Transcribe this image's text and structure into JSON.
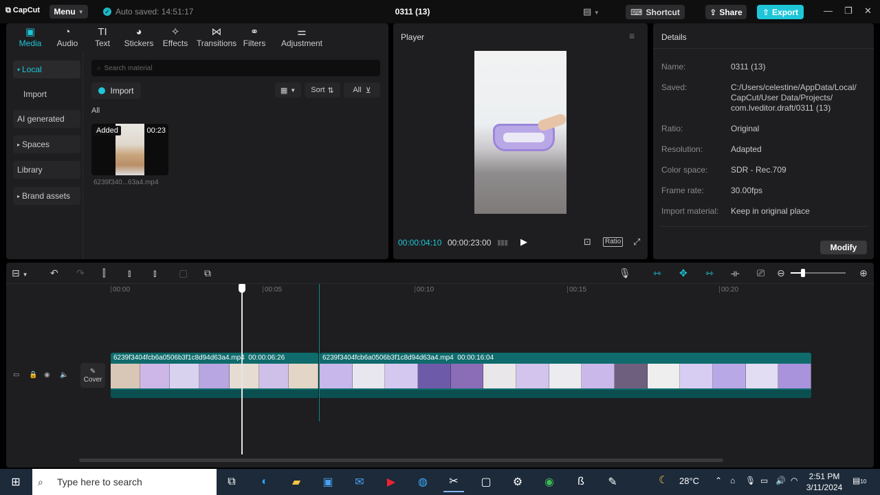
{
  "titlebar": {
    "logo": "CapCut",
    "menu_label": "Menu",
    "autosave_text": "Auto saved: 14:51:17",
    "project_title": "0311 (13)",
    "shortcut_label": "Shortcut",
    "share_label": "Share",
    "export_label": "Export"
  },
  "tabs": [
    {
      "label": "Media",
      "icon": "media-icon",
      "glyph": "▣",
      "active": true
    },
    {
      "label": "Audio",
      "icon": "audio-icon",
      "glyph": "◔"
    },
    {
      "label": "Text",
      "icon": "text-icon",
      "glyph": "TI"
    },
    {
      "label": "Stickers",
      "icon": "stickers-icon",
      "glyph": "◕"
    },
    {
      "label": "Effects",
      "icon": "effects-icon",
      "glyph": "✧"
    },
    {
      "label": "Transitions",
      "icon": "transitions-icon",
      "glyph": "⋈"
    },
    {
      "label": "Filters",
      "icon": "filters-icon",
      "glyph": "⚭"
    },
    {
      "label": "Adjustment",
      "icon": "adjustment-icon",
      "glyph": "⚌"
    }
  ],
  "sidebar": {
    "items": [
      {
        "label": "Local",
        "prefix": "▾"
      },
      {
        "label": "Import",
        "prefix": ""
      },
      {
        "label": "AI generated",
        "prefix": ""
      },
      {
        "label": "Spaces",
        "prefix": "▸"
      },
      {
        "label": "Library",
        "prefix": ""
      },
      {
        "label": "Brand assets",
        "prefix": "▸"
      }
    ]
  },
  "media": {
    "search_placeholder": "Search material",
    "import_label": "Import",
    "sort_label": "Sort",
    "filter_label": "All",
    "section_label": "All",
    "item": {
      "badge": "Added",
      "duration": "00:23",
      "filename": "6239f340...63a4.mp4"
    }
  },
  "player": {
    "title": "Player",
    "current_time": "00:00:04:10",
    "total_time": "00:00:23:00",
    "ratio_label": "Ratio"
  },
  "details": {
    "title": "Details",
    "rows": [
      {
        "key": "Name:",
        "value": "0311 (13)"
      },
      {
        "key": "Saved:",
        "value": "C:/Users/celestine/AppData/Local/ CapCut/User Data/Projects/ com.lveditor.draft/0311 (13)"
      },
      {
        "key": "Ratio:",
        "value": "Original"
      },
      {
        "key": "Resolution:",
        "value": "Adapted"
      },
      {
        "key": "Color space:",
        "value": "SDR - Rec.709"
      },
      {
        "key": "Frame rate:",
        "value": "30.00fps"
      },
      {
        "key": "Import material:",
        "value": "Keep in original place"
      }
    ],
    "modify_label": "Modify"
  },
  "timeline": {
    "ruler": [
      "00:00",
      "00:05",
      "00:10",
      "00:15",
      "00:20"
    ],
    "cover_label": "Cover",
    "clips": [
      {
        "name": "6239f3404fcb6a0506b3f1c8d94d63a4.mp4",
        "duration": "00:00:06:26"
      },
      {
        "name": "6239f3404fcb6a0506b3f1c8d94d63a4.mp4",
        "duration": "00:00:16:04"
      }
    ]
  },
  "taskbar": {
    "search_placeholder": "Type here to search",
    "weather": "28°C",
    "time": "2:51 PM",
    "date": "3/11/2024",
    "notif_count": "10"
  },
  "colors": {
    "accent": "#1ec6d8",
    "clip": "#0f6b6c",
    "panel": "#1e1e20"
  }
}
